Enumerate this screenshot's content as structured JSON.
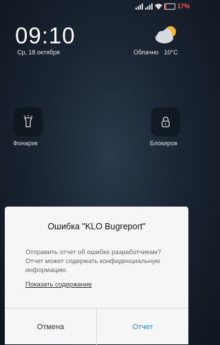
{
  "status_bar": {
    "battery_percent": "17%",
    "battery_color": "#ff5a5a"
  },
  "lockscreen": {
    "time": "09:10",
    "date": "Ср, 18 октября",
    "weather": {
      "condition": "Облачно",
      "temperature": "10°C",
      "icon": "partly-cloudy-icon"
    }
  },
  "shortcuts": [
    {
      "label": "Фонарик",
      "icon": "flashlight-icon"
    },
    {
      "label": "Блокиров",
      "icon": "lock-icon"
    }
  ],
  "dialog": {
    "title": "Ошибка \"KLO Bugreport\"",
    "message": "Отправить отчет об ошибке разработчикам? Отчет может содержать конфиденциальную информацию.",
    "show_details": "Показать содержание",
    "cancel_label": "Отмена",
    "report_label": "Отчет",
    "accent_color": "#2f8de4"
  }
}
